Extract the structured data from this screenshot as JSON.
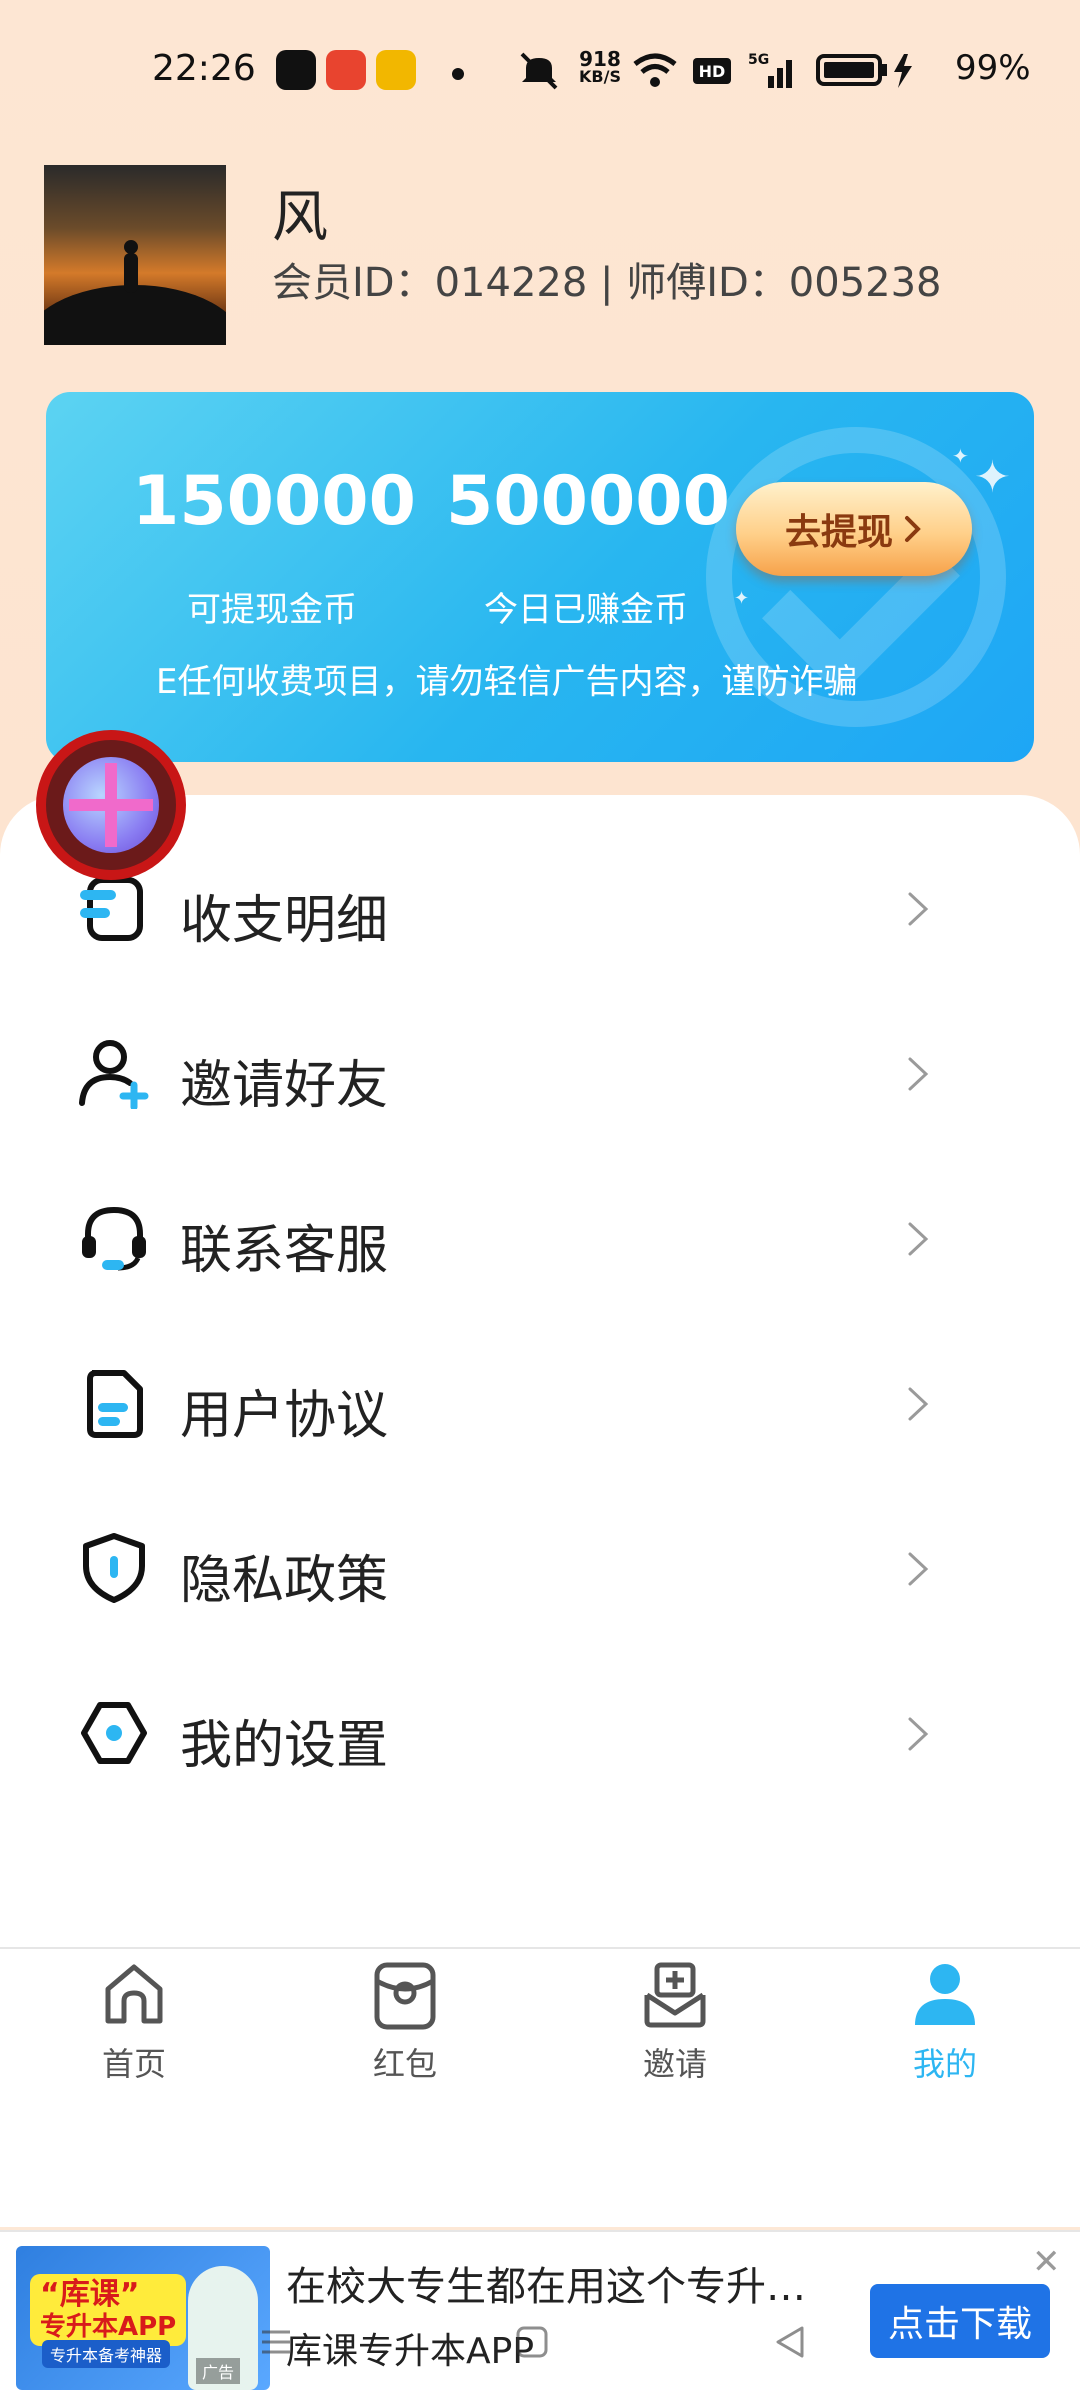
{
  "status_bar": {
    "time": "22:26",
    "network_speed_top": "918",
    "network_speed_unit": "KB/S",
    "battery": "99%"
  },
  "profile": {
    "name": "风",
    "ids": "会员ID：014228 | 师傅ID：005238"
  },
  "balance_card": {
    "withdrawable_value": "150000",
    "withdrawable_label": "可提现金币",
    "today_value": "500000",
    "today_label": "今日已赚金币",
    "withdraw_button": "去提现",
    "notice": "E任何收费项目，请勿轻信广告内容，谨防诈骗"
  },
  "menu": {
    "items": [
      {
        "label": "收支明细",
        "icon": "ledger-icon"
      },
      {
        "label": "邀请好友",
        "icon": "add-user-icon"
      },
      {
        "label": "联系客服",
        "icon": "headset-icon"
      },
      {
        "label": "用户协议",
        "icon": "document-icon"
      },
      {
        "label": "隐私政策",
        "icon": "shield-icon"
      },
      {
        "label": "我的设置",
        "icon": "settings-icon"
      }
    ]
  },
  "tabbar": {
    "tabs": [
      {
        "label": "首页",
        "icon": "home-icon"
      },
      {
        "label": "红包",
        "icon": "red-packet-icon"
      },
      {
        "label": "邀请",
        "icon": "invite-icon"
      },
      {
        "label": "我的",
        "icon": "profile-icon"
      }
    ],
    "active_color": "#2db6f2"
  },
  "ad": {
    "image_title_line1": "“库课”",
    "image_title_line2": "专升本APP",
    "image_sub": "专升本备考神器",
    "title": "在校大专生都在用这个专升…",
    "subtitle": "库课专升本APP",
    "button": "点击下载",
    "ad_mark": "广告"
  },
  "colors": {
    "background": "#fde6d3",
    "card_start": "#5cd3f2",
    "card_end": "#1ea6f5",
    "accent": "#2db6f2"
  }
}
